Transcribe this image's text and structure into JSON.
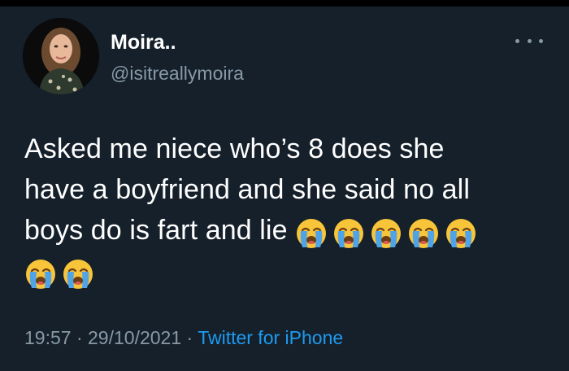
{
  "tweet": {
    "author": {
      "name": "Moira..",
      "handle": "@isitreallymoira"
    },
    "text_line1": "Asked me niece who’s 8 does she",
    "text_line2": "have a boyfriend and she said no all",
    "text_line3": "boys do is fart and lie",
    "emoji_name": "loudly-crying-face-icon",
    "emoji_count": 7,
    "time": "19:57",
    "date": "29/10/2021",
    "separator": "·",
    "source": "Twitter for iPhone"
  },
  "colors": {
    "background": "#15202b",
    "text": "#ffffff",
    "secondary_text": "#8899a6",
    "link": "#1d9bf0",
    "emoji_face": "#f8c43a",
    "emoji_tears": "#4fa3e8"
  }
}
